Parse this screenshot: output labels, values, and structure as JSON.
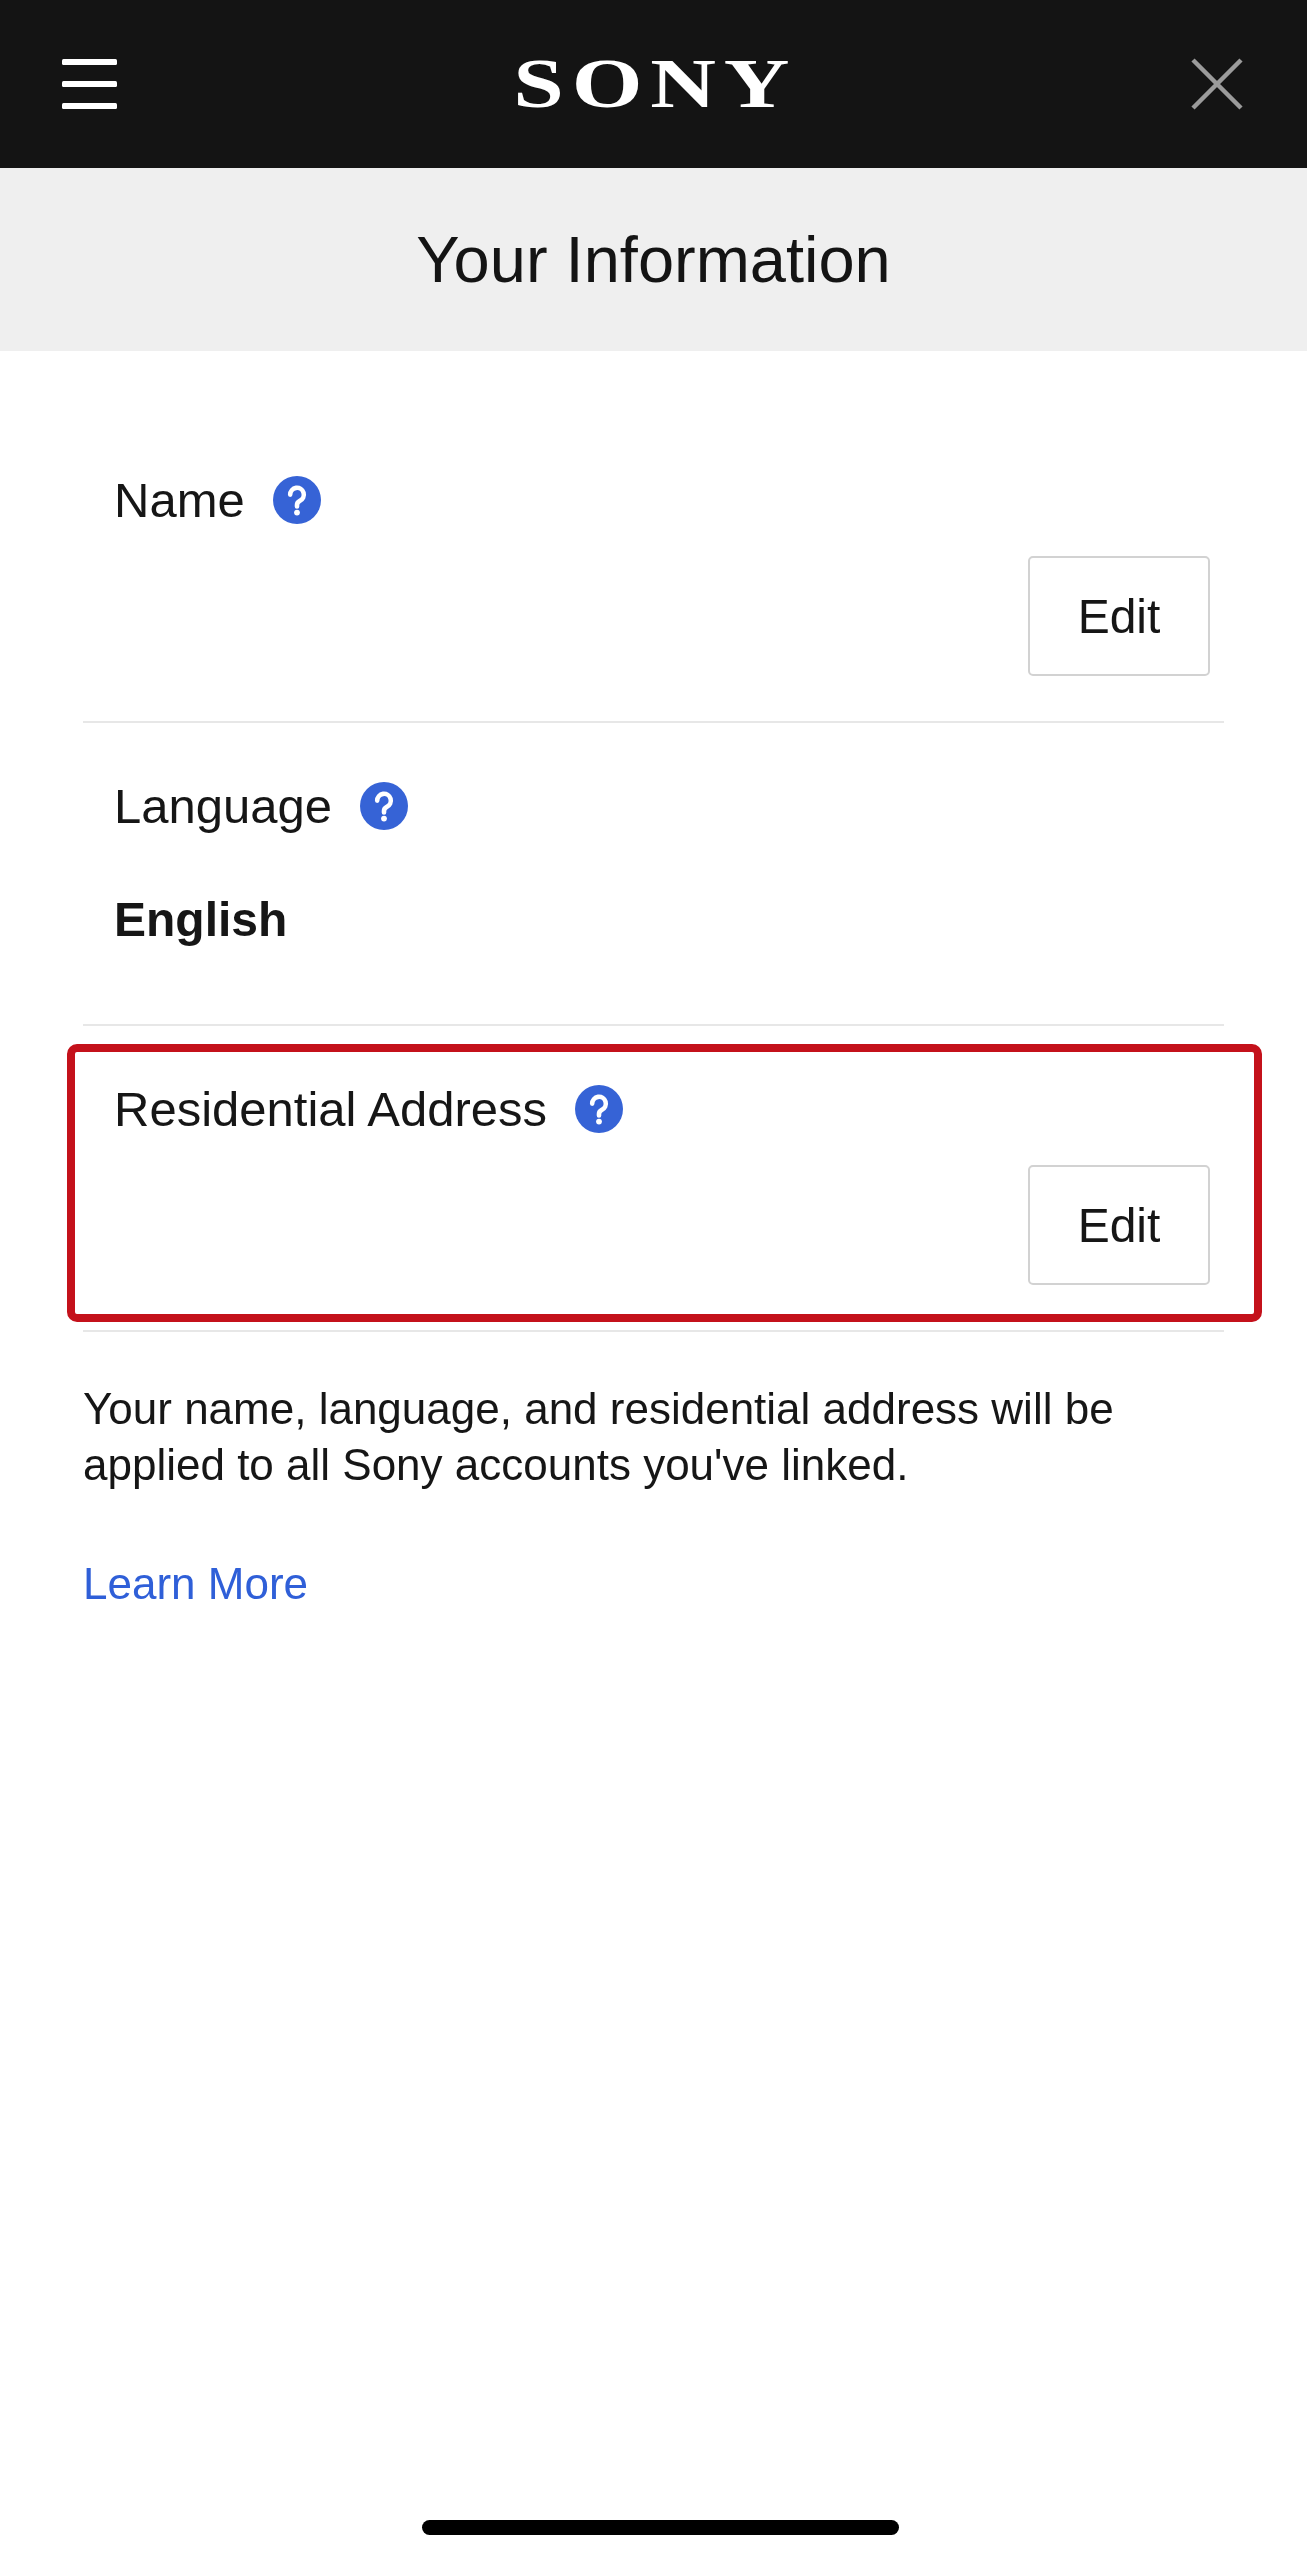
{
  "header": {
    "logo": "SONY"
  },
  "page_title": "Your Information",
  "sections": [
    {
      "kind": "edit",
      "label": "Name",
      "button": "Edit",
      "highlighted": false
    },
    {
      "kind": "value",
      "label": "Language",
      "value": "English",
      "highlighted": false
    },
    {
      "kind": "edit",
      "label": "Residential Address",
      "button": "Edit",
      "highlighted": true
    }
  ],
  "note": "Your name, language, and residential address will be applied to all Sony accounts you've linked.",
  "link": "Learn More"
}
